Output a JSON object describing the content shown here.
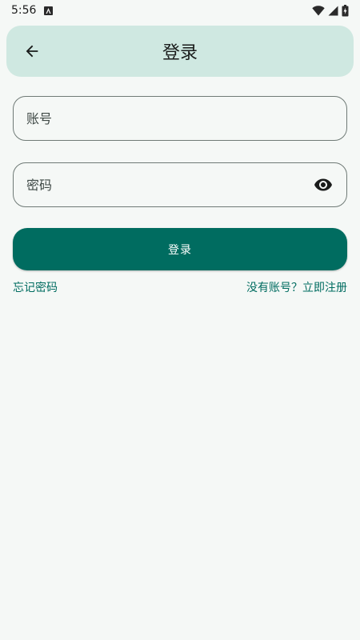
{
  "status_bar": {
    "time": "5:56",
    "icons": [
      "notification-a-icon",
      "wifi-icon",
      "signal-icon",
      "battery-charging-icon"
    ]
  },
  "app_bar": {
    "title": "登录",
    "back_icon": "arrow-left-icon",
    "background": "#cfe8e1"
  },
  "form": {
    "account_placeholder": "账号",
    "account_value": "",
    "password_placeholder": "密码",
    "password_value": "",
    "password_toggle_icon": "eye-icon"
  },
  "login_button": {
    "label": "登录",
    "color": "#006c60"
  },
  "links": {
    "forgot": "忘记密码",
    "register": "没有账号？立即注册"
  },
  "colors": {
    "accent": "#006c60",
    "background": "#f5f8f6",
    "outline": "#6f7a76"
  }
}
